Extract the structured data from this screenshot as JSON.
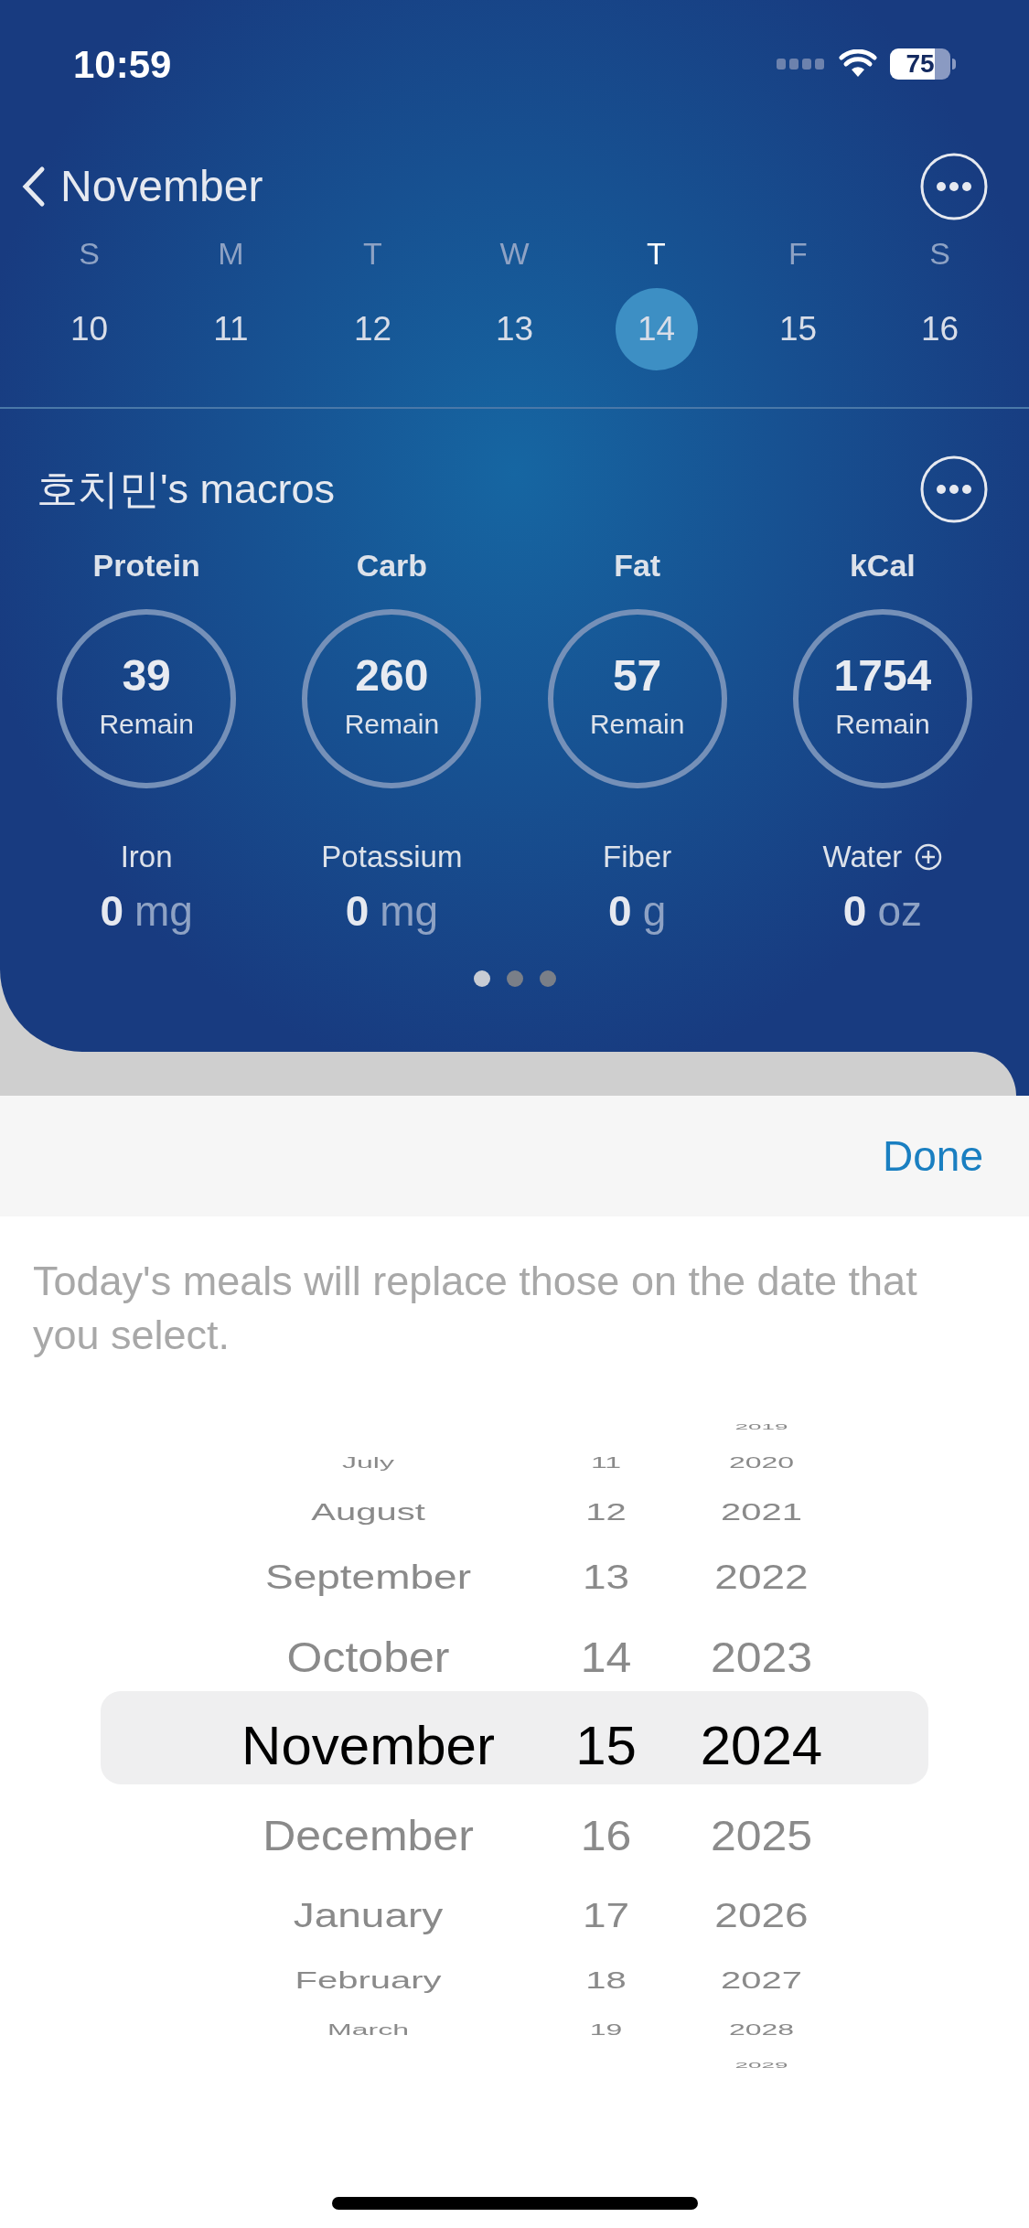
{
  "status_bar": {
    "time": "10:59",
    "battery": "75"
  },
  "header": {
    "month": "November"
  },
  "week": [
    {
      "day": "S",
      "date": "10",
      "selected": false
    },
    {
      "day": "M",
      "date": "11",
      "selected": false
    },
    {
      "day": "T",
      "date": "12",
      "selected": false
    },
    {
      "day": "W",
      "date": "13",
      "selected": false
    },
    {
      "day": "T",
      "date": "14",
      "selected": true
    },
    {
      "day": "F",
      "date": "15",
      "selected": false
    },
    {
      "day": "S",
      "date": "16",
      "selected": false
    }
  ],
  "macros": {
    "title": "호치민's macros",
    "rings": [
      {
        "label": "Protein",
        "value": "39",
        "caption": "Remain"
      },
      {
        "label": "Carb",
        "value": "260",
        "caption": "Remain"
      },
      {
        "label": "Fat",
        "value": "57",
        "caption": "Remain"
      },
      {
        "label": "kCal",
        "value": "1754",
        "caption": "Remain"
      }
    ],
    "nutrients": [
      {
        "label": "Iron",
        "value": "0",
        "unit": "mg",
        "addable": false
      },
      {
        "label": "Potassium",
        "value": "0",
        "unit": "mg",
        "addable": false
      },
      {
        "label": "Fiber",
        "value": "0",
        "unit": "g",
        "addable": false
      },
      {
        "label": "Water",
        "value": "0",
        "unit": "oz",
        "addable": true
      }
    ],
    "pages": [
      {
        "selected": true
      },
      {
        "selected": false
      },
      {
        "selected": false
      }
    ]
  },
  "sheet": {
    "done": "Done",
    "message": "Today's meals will replace those on the date that you select."
  },
  "picker": {
    "months": [
      {
        "label": "July",
        "selected": false
      },
      {
        "label": "August",
        "selected": false
      },
      {
        "label": "September",
        "selected": false
      },
      {
        "label": "October",
        "selected": false
      },
      {
        "label": "November",
        "selected": true
      },
      {
        "label": "December",
        "selected": false
      },
      {
        "label": "January",
        "selected": false
      },
      {
        "label": "February",
        "selected": false
      },
      {
        "label": "March",
        "selected": false
      }
    ],
    "days": [
      {
        "label": "11",
        "selected": false
      },
      {
        "label": "12",
        "selected": false
      },
      {
        "label": "13",
        "selected": false
      },
      {
        "label": "14",
        "selected": false
      },
      {
        "label": "15",
        "selected": true
      },
      {
        "label": "16",
        "selected": false
      },
      {
        "label": "17",
        "selected": false
      },
      {
        "label": "18",
        "selected": false
      },
      {
        "label": "19",
        "selected": false
      }
    ],
    "years": [
      {
        "label": "2019",
        "selected": false
      },
      {
        "label": "2020",
        "selected": false
      },
      {
        "label": "2021",
        "selected": false
      },
      {
        "label": "2022",
        "selected": false
      },
      {
        "label": "2023",
        "selected": false
      },
      {
        "label": "2024",
        "selected": true
      },
      {
        "label": "2025",
        "selected": false
      },
      {
        "label": "2026",
        "selected": false
      },
      {
        "label": "2027",
        "selected": false
      },
      {
        "label": "2028",
        "selected": false
      },
      {
        "label": "2029",
        "selected": false
      }
    ]
  }
}
